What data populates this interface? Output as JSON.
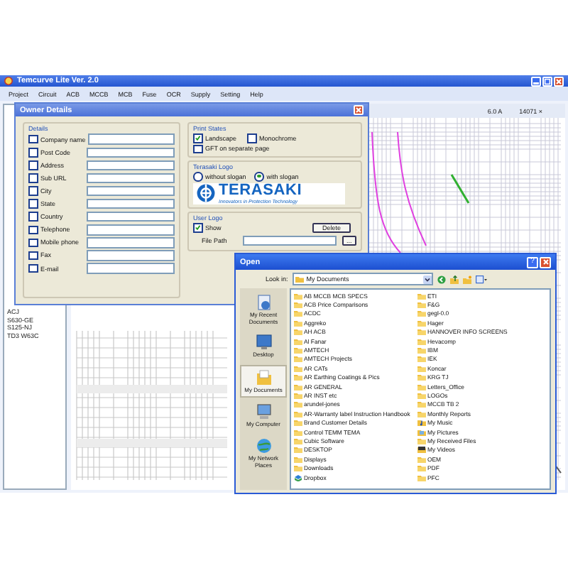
{
  "window": {
    "title": "Temcurve Lite Ver. 2.0"
  },
  "menu": [
    "Project",
    "Circuit",
    "ACB",
    "MCCB",
    "MCB",
    "Fuse",
    "OCR",
    "Supply",
    "Setting",
    "Help"
  ],
  "readings": [
    "6.0 A",
    "14071 ×"
  ],
  "device_list": [
    "ACJ",
    "S630-GE",
    "S125-NJ",
    "TD3 W63C"
  ],
  "owner_dialog": {
    "title": "Owner Details",
    "details_title": "Details",
    "fields": [
      {
        "label": "Company name",
        "checked": false
      },
      {
        "label": "Post Code",
        "checked": false
      },
      {
        "label": "Address",
        "checked": false
      },
      {
        "label": "Sub URL",
        "checked": false
      },
      {
        "label": "City",
        "checked": false
      },
      {
        "label": "State",
        "checked": false
      },
      {
        "label": "Country",
        "checked": false
      },
      {
        "label": "Telephone",
        "checked": false
      },
      {
        "label": "Mobile phone",
        "checked": false
      },
      {
        "label": "Fax",
        "checked": false
      },
      {
        "label": "E-mail",
        "checked": false
      }
    ],
    "print_states": {
      "title": "Print States",
      "options": [
        {
          "label": "Landscape",
          "checked": true
        },
        {
          "label": "Monochrome",
          "checked": false
        },
        {
          "label": "GFT on separate page",
          "checked": false
        }
      ]
    },
    "terasaki_logo": {
      "title": "Terasaki Logo",
      "options": [
        {
          "label": "without slogan",
          "selected": false
        },
        {
          "label": "with slogan",
          "selected": true
        }
      ],
      "brand": "TERASAKI",
      "slogan": "Innovators in Protection Technology"
    },
    "user_logo": {
      "title": "User Logo",
      "show": {
        "label": "Show",
        "checked": true
      },
      "delete_button": "Delete",
      "file_path_label": "File Path",
      "browse_button": "..."
    }
  },
  "open_dialog": {
    "title": "Open",
    "help_button": "?",
    "look_in_label": "Look in:",
    "look_in": "My Documents",
    "places": [
      {
        "label": "My Recent Documents",
        "kind": "recent",
        "selected": false
      },
      {
        "label": "Desktop",
        "kind": "desktop",
        "selected": false
      },
      {
        "label": "My Documents",
        "kind": "documents",
        "selected": true
      },
      {
        "label": "My Computer",
        "kind": "computer",
        "selected": false
      },
      {
        "label": "My Network Places",
        "kind": "network",
        "selected": false
      }
    ],
    "files": [
      {
        "name": "AB MCCB MCB SPECS",
        "kind": "folder"
      },
      {
        "name": "ACB Price Comparisons",
        "kind": "folder"
      },
      {
        "name": "ACDC",
        "kind": "folder"
      },
      {
        "name": "Aggreko",
        "kind": "folder"
      },
      {
        "name": "AH ACB",
        "kind": "folder"
      },
      {
        "name": "Al Fanar",
        "kind": "folder"
      },
      {
        "name": "AMTECH",
        "kind": "folder"
      },
      {
        "name": "AMTECH Projects",
        "kind": "folder"
      },
      {
        "name": "AR CATs",
        "kind": "folder"
      },
      {
        "name": "AR Earthing Coatings & Pics",
        "kind": "folder"
      },
      {
        "name": "AR GENERAL",
        "kind": "folder"
      },
      {
        "name": "AR INST etc",
        "kind": "folder"
      },
      {
        "name": "arundel-jones",
        "kind": "folder"
      },
      {
        "name": "AR-Warranty label Instruction Handbook",
        "kind": "folder"
      },
      {
        "name": "Brand Customer Details",
        "kind": "folder"
      },
      {
        "name": "Control TEMM TEMA",
        "kind": "folder"
      },
      {
        "name": "Cubic Software",
        "kind": "folder"
      },
      {
        "name": "DESKTOP",
        "kind": "folder"
      },
      {
        "name": "Displays",
        "kind": "folder"
      },
      {
        "name": "Downloads",
        "kind": "folder"
      },
      {
        "name": "Dropbox",
        "kind": "sync"
      },
      {
        "name": "ETI",
        "kind": "folder"
      },
      {
        "name": "F&G",
        "kind": "folder"
      },
      {
        "name": "gegl-0.0",
        "kind": "folder"
      },
      {
        "name": "Hager",
        "kind": "folder"
      },
      {
        "name": "HANNOVER INFO SCREENS",
        "kind": "folder"
      },
      {
        "name": "Hevacomp",
        "kind": "folder"
      },
      {
        "name": "IBM",
        "kind": "folder"
      },
      {
        "name": "IEK",
        "kind": "folder"
      },
      {
        "name": "Koncar",
        "kind": "folder"
      },
      {
        "name": "KRG TJ",
        "kind": "folder"
      },
      {
        "name": "Letters_Office",
        "kind": "folder"
      },
      {
        "name": "LOGOs",
        "kind": "folder"
      },
      {
        "name": "MCCB TB 2",
        "kind": "folder"
      },
      {
        "name": "Monthly Reports",
        "kind": "folder"
      },
      {
        "name": "My Music",
        "kind": "music"
      },
      {
        "name": "My Pictures",
        "kind": "pictures"
      },
      {
        "name": "My Received Files",
        "kind": "folder"
      },
      {
        "name": "My Videos",
        "kind": "videos"
      },
      {
        "name": "OEM",
        "kind": "folder"
      },
      {
        "name": "PDF",
        "kind": "folder"
      },
      {
        "name": "PFC",
        "kind": "folder"
      }
    ]
  }
}
